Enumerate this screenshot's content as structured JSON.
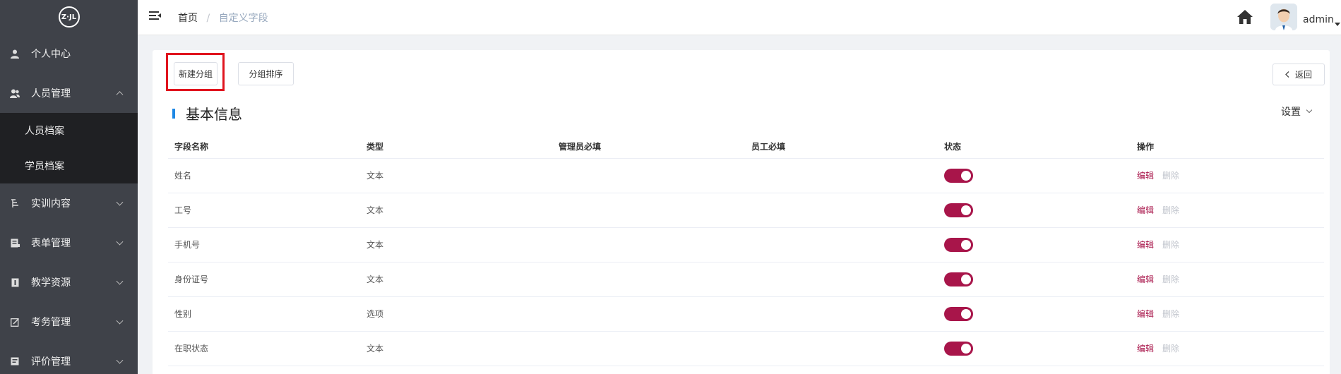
{
  "logo": {
    "text": "Z·JL"
  },
  "sidebar": {
    "items": [
      {
        "label": "个人中心",
        "icon": "user-icon",
        "expanded": false,
        "has_children": false
      },
      {
        "label": "人员管理",
        "icon": "users-icon",
        "expanded": true,
        "has_children": true,
        "children": [
          {
            "label": "人员档案"
          },
          {
            "label": "学员档案"
          }
        ]
      },
      {
        "label": "实训内容",
        "icon": "training-icon",
        "expanded": false,
        "has_children": true
      },
      {
        "label": "表单管理",
        "icon": "form-icon",
        "expanded": false,
        "has_children": true
      },
      {
        "label": "教学资源",
        "icon": "resource-icon",
        "expanded": false,
        "has_children": true
      },
      {
        "label": "考务管理",
        "icon": "exam-icon",
        "expanded": false,
        "has_children": true
      },
      {
        "label": "评价管理",
        "icon": "evaluation-icon",
        "expanded": false,
        "has_children": true
      }
    ]
  },
  "header": {
    "breadcrumb": {
      "home": "首页",
      "separator": "/",
      "current": "自定义字段"
    },
    "user": {
      "name": "admin"
    }
  },
  "toolbar": {
    "new_group": "新建分组",
    "sort_group": "分组排序",
    "back": "返回"
  },
  "section": {
    "title": "基本信息",
    "settings": "设置"
  },
  "table": {
    "columns": [
      "字段名称",
      "类型",
      "管理员必填",
      "员工必填",
      "状态",
      "操作"
    ],
    "rows": [
      {
        "name": "姓名",
        "type": "文本",
        "admin_required": "",
        "staff_required": "",
        "status": true
      },
      {
        "name": "工号",
        "type": "文本",
        "admin_required": "",
        "staff_required": "",
        "status": true
      },
      {
        "name": "手机号",
        "type": "文本",
        "admin_required": "",
        "staff_required": "",
        "status": true
      },
      {
        "name": "身份证号",
        "type": "文本",
        "admin_required": "",
        "staff_required": "",
        "status": true
      },
      {
        "name": "性别",
        "type": "选项",
        "admin_required": "",
        "staff_required": "",
        "status": true
      },
      {
        "name": "在职状态",
        "type": "文本",
        "admin_required": "",
        "staff_required": "",
        "status": true
      }
    ],
    "actions": {
      "edit": "编辑",
      "delete": "删除"
    }
  },
  "colors": {
    "sidebar_bg": "#3f4249",
    "submenu_bg": "#1f2023",
    "accent": "#a8154a",
    "section_bar": "#1e88e5",
    "highlight": "#e0141e"
  }
}
